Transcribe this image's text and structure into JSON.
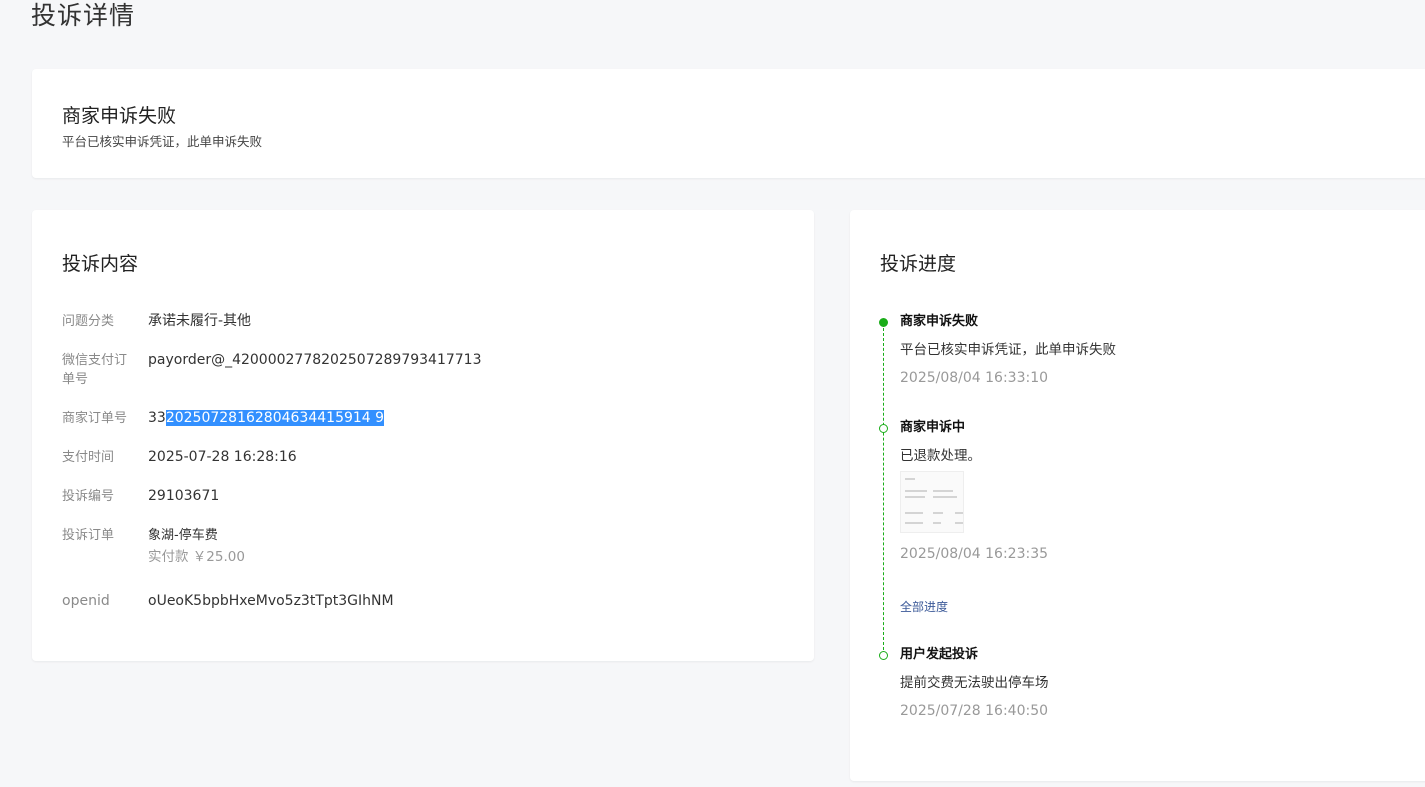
{
  "page": {
    "title": "投诉详情"
  },
  "status": {
    "title": "商家申诉失败",
    "description": "平台已核实申诉凭证，此单申诉失败"
  },
  "complaint": {
    "heading": "投诉内容",
    "rows": {
      "category": {
        "label": "问题分类",
        "value": "承诺未履行-其他"
      },
      "wechat_order": {
        "label_line1": "微信支付订",
        "label_line2": "单号",
        "value": "payorder@_4200002778202507289793417713"
      },
      "merchant_order": {
        "label": "商家订单号",
        "value_prefix": "33",
        "value_selected": "20250728162804634415914 9"
      },
      "pay_time": {
        "label": "支付时间",
        "value": "2025-07-28 16:28:16"
      },
      "complaint_no": {
        "label": "投诉编号",
        "value": "29103671"
      },
      "complaint_order": {
        "label": "投诉订单",
        "value": "象湖-停车费",
        "sub": "实付款 ￥25.00"
      },
      "openid": {
        "label": "openid",
        "value": "oUeoK5bpbHxeMvo5z3tTpt3GIhNM"
      }
    }
  },
  "progress": {
    "heading": "投诉进度",
    "accent_color": "#1aad19",
    "items": [
      {
        "title": "商家申诉失败",
        "desc": "平台已核实申诉凭证，此单申诉失败",
        "time": "2025/08/04 16:33:10"
      },
      {
        "title": "商家申诉中",
        "desc": "已退款处理。",
        "time": "2025/08/04 16:23:35"
      },
      {
        "title": "用户发起投诉",
        "desc": "提前交费无法驶出停车场",
        "time": "2025/07/28 16:40:50"
      }
    ],
    "all_link": "全部进度"
  }
}
